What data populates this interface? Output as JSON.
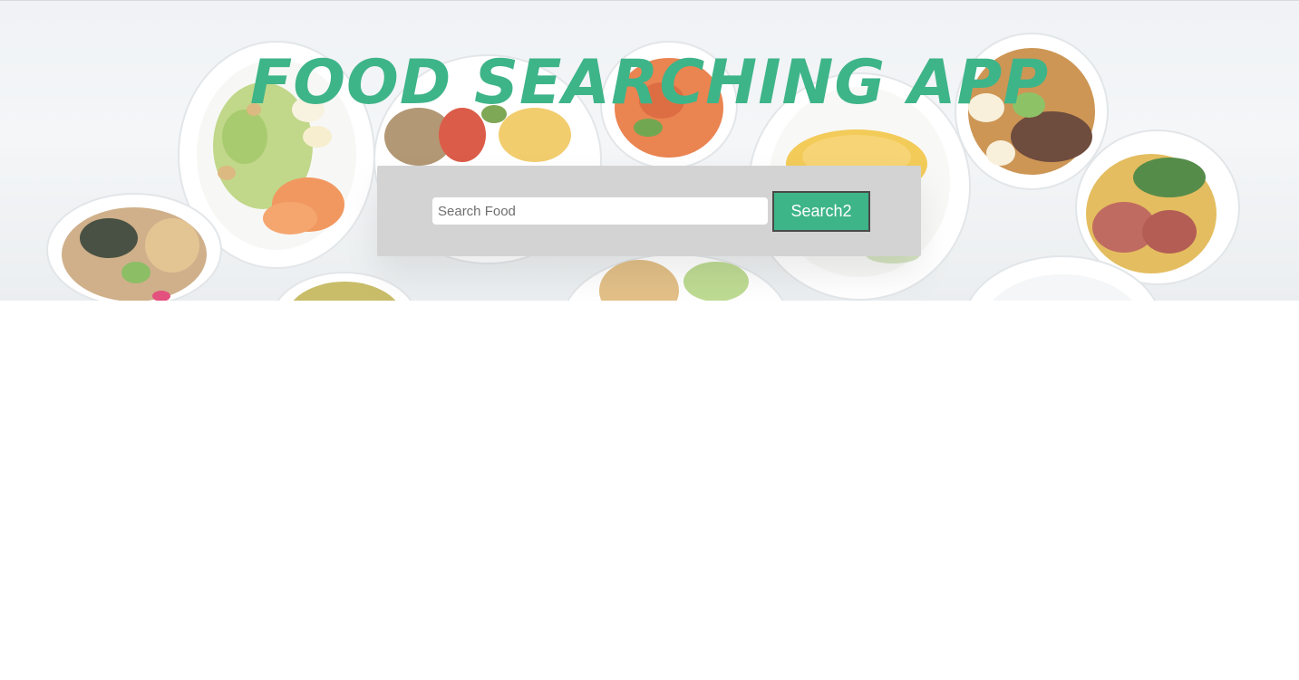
{
  "hero": {
    "title": "FOOD SEARCHING APP",
    "background_icon": "food-plates-photo"
  },
  "search": {
    "placeholder": "Search Food",
    "value": "",
    "button_label": "Search2"
  },
  "colors": {
    "accent": "#3eb489",
    "panel": "#d3d3d3",
    "button_border": "#4a4a4a"
  }
}
